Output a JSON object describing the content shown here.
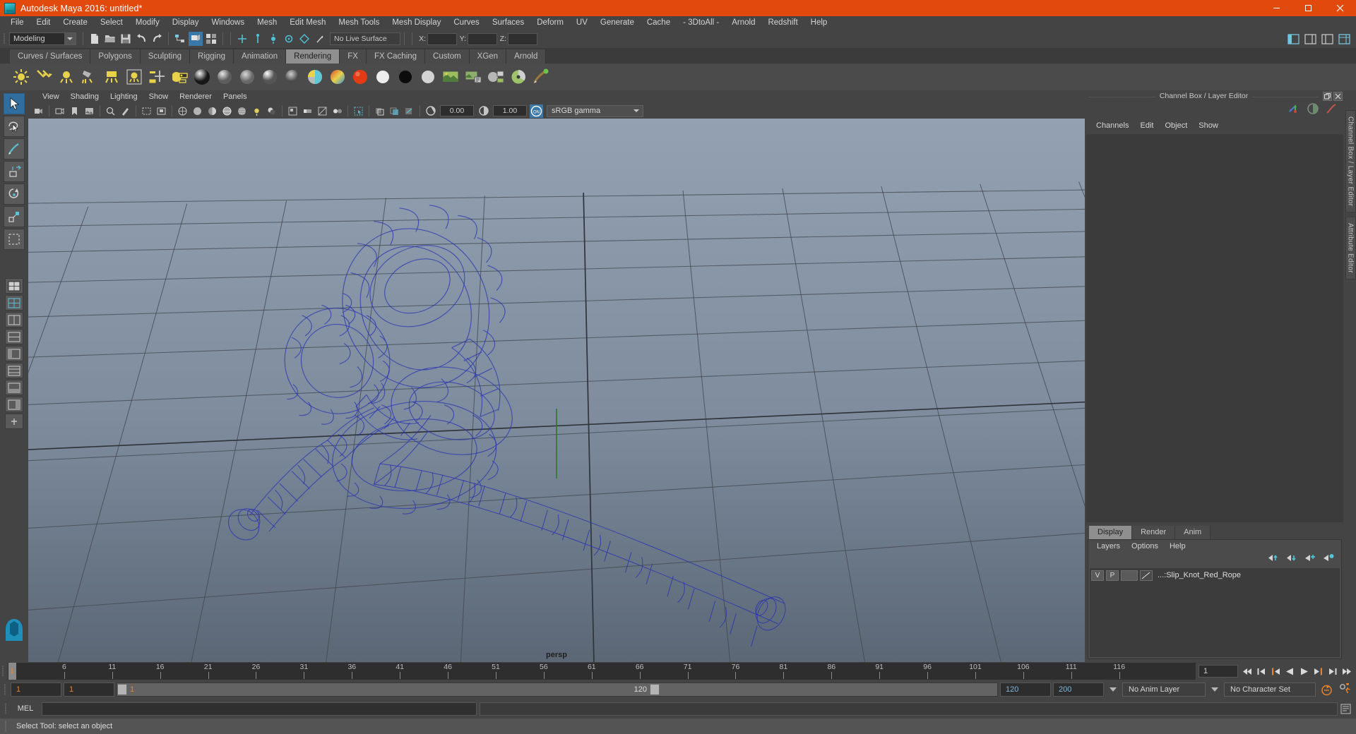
{
  "window": {
    "title": "Autodesk Maya 2016: untitled*",
    "logo_icon": "maya-logo-icon",
    "minimize_label": "─",
    "maximize_label": "❐",
    "close_label": "✕",
    "titlebar_color": "#e2490c"
  },
  "menubar": {
    "items": [
      {
        "label": "File"
      },
      {
        "label": "Edit"
      },
      {
        "label": "Create"
      },
      {
        "label": "Select"
      },
      {
        "label": "Modify"
      },
      {
        "label": "Display"
      },
      {
        "label": "Windows"
      },
      {
        "label": "Mesh"
      },
      {
        "label": "Edit Mesh"
      },
      {
        "label": "Mesh Tools"
      },
      {
        "label": "Mesh Display"
      },
      {
        "label": "Curves"
      },
      {
        "label": "Surfaces"
      },
      {
        "label": "Deform"
      },
      {
        "label": "UV"
      },
      {
        "label": "Generate"
      },
      {
        "label": "Cache"
      },
      {
        "label": "- 3DtoAll -"
      },
      {
        "label": "Arnold"
      },
      {
        "label": "Redshift"
      },
      {
        "label": "Help"
      }
    ]
  },
  "statusline": {
    "mode": "Modeling",
    "live_surface": "No Live Surface",
    "coord_x_label": "X:",
    "coord_y_label": "Y:",
    "coord_z_label": "Z:",
    "coord_x_value": "",
    "coord_y_value": "",
    "coord_z_value": ""
  },
  "shelf": {
    "tabs": [
      {
        "label": "Curves / Surfaces",
        "active": false
      },
      {
        "label": "Polygons",
        "active": false
      },
      {
        "label": "Sculpting",
        "active": false
      },
      {
        "label": "Rigging",
        "active": false
      },
      {
        "label": "Animation",
        "active": false
      },
      {
        "label": "Rendering",
        "active": true
      },
      {
        "label": "FX",
        "active": false
      },
      {
        "label": "FX Caching",
        "active": false
      },
      {
        "label": "Custom",
        "active": false
      },
      {
        "label": "XGen",
        "active": false
      },
      {
        "label": "Arnold",
        "active": false
      }
    ],
    "icons": [
      "ambient-light-icon",
      "directional-light-icon",
      "point-light-icon",
      "spot-light-icon",
      "area-light-icon",
      "volume-light-icon",
      "light-linking-icon",
      "batch-render-icon",
      "sphere-shader-ball-icon",
      "blinn-shader-icon",
      "lambert-shader-icon",
      "phong-shader-icon",
      "anisotropic-shader-icon",
      "layered-shader-icon",
      "ramp-shader-icon",
      "red-material-icon",
      "white-material-icon",
      "black-material-icon",
      "grey-material-icon",
      "render-view-icon",
      "render-settings-icon",
      "hypershade-icon",
      "render-current-frame-icon",
      "paint-effects-icon"
    ]
  },
  "toolbox": {
    "tools": [
      {
        "name": "select-tool",
        "selected": true
      },
      {
        "name": "lasso-tool",
        "selected": false
      },
      {
        "name": "paint-select-tool",
        "selected": false
      },
      {
        "name": "move-tool",
        "selected": false
      },
      {
        "name": "rotate-tool",
        "selected": false
      },
      {
        "name": "scale-tool",
        "selected": false
      },
      {
        "name": "last-tool",
        "selected": false
      }
    ],
    "layouts": [
      "single-pane-layout",
      "two-pane-side-layout",
      "two-pane-stacked-layout",
      "four-pane-layout",
      "outliner-persp-layout",
      "hypergraph-layout",
      "persp-graph-layout",
      "persp-outliner-layout",
      "expand-layout"
    ]
  },
  "panel": {
    "menus": [
      {
        "label": "View"
      },
      {
        "label": "Shading"
      },
      {
        "label": "Lighting"
      },
      {
        "label": "Show"
      },
      {
        "label": "Renderer"
      },
      {
        "label": "Panels"
      }
    ],
    "exposure_value": "0.00",
    "gamma_value": "1.00",
    "color_toggle_label": "ON",
    "view_transform": "sRGB gamma",
    "camera_label": "persp"
  },
  "viewport": {
    "object_name": "Slip_Knot_Red_Rope",
    "wireframe_color": "#2b35b0",
    "bg_top": "#8f9db0",
    "bg_bottom": "#5e6b7c",
    "grid_color": "#3f4750"
  },
  "channelbox": {
    "panel_title": "Channel Box / Layer Editor",
    "menus": [
      {
        "label": "Channels"
      },
      {
        "label": "Edit"
      },
      {
        "label": "Object"
      },
      {
        "label": "Show"
      }
    ],
    "restore_label": "❐",
    "close_label": "✕",
    "icons": [
      "channel-box-icon",
      "attribute-editor-icon",
      "anim-curve-icon"
    ]
  },
  "layereditor": {
    "tabs": [
      {
        "label": "Display",
        "active": true
      },
      {
        "label": "Render",
        "active": false
      },
      {
        "label": "Anim",
        "active": false
      }
    ],
    "menus": [
      {
        "label": "Layers"
      },
      {
        "label": "Options"
      },
      {
        "label": "Help"
      }
    ],
    "buttons": [
      "move-layer-up-icon",
      "move-layer-down-icon",
      "new-layer-icon",
      "new-layer-from-selected-icon"
    ],
    "layers": [
      {
        "visibility": "V",
        "playback": "P",
        "color": "",
        "name": "...:Slip_Knot_Red_Rope"
      }
    ]
  },
  "vtabs": [
    {
      "label": "Channel Box / Layer Editor"
    },
    {
      "label": "Attribute Editor"
    }
  ],
  "timeslider": {
    "start": 1,
    "end": 120,
    "tick_step": 5,
    "current_frame": "1",
    "current_field": "1",
    "playback_buttons": [
      "go-to-start-icon",
      "step-back-key-icon",
      "step-back-frame-icon",
      "play-backwards-icon",
      "play-forwards-icon",
      "step-forward-frame-icon",
      "step-forward-key-icon",
      "go-to-end-icon"
    ]
  },
  "rangeslider": {
    "anim_start": "1",
    "anim_start2": "1",
    "range_start": "1",
    "range_end": "120",
    "playback_end": "120",
    "anim_end": "200",
    "anim_layer": "No Anim Layer",
    "character_set": "No Character Set",
    "auto_key_icon": "auto-keyframe-icon",
    "anim_prefs_icon": "animation-preferences-icon"
  },
  "commandline": {
    "language_label": "MEL",
    "input_value": "",
    "output_value": ""
  },
  "statusbar": {
    "help_text": "Select Tool: select an object"
  }
}
